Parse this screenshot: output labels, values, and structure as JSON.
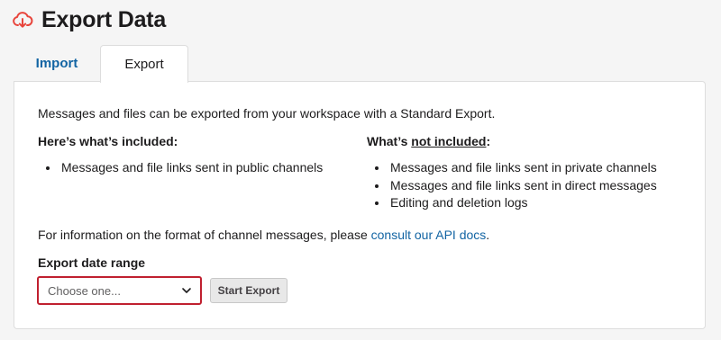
{
  "header": {
    "title": "Export Data",
    "icon": "cloud-download-icon",
    "icon_color": "#e8453c"
  },
  "tabs": [
    {
      "label": "Import",
      "active": false
    },
    {
      "label": "Export",
      "active": true
    }
  ],
  "panel": {
    "intro": "Messages and files can be exported from your workspace with a Standard Export.",
    "included": {
      "heading": "Here’s what’s included:",
      "items": [
        "Messages and file links sent in public channels"
      ]
    },
    "not_included": {
      "heading_prefix": "What’s ",
      "heading_underlined": "not included",
      "heading_suffix": ":",
      "items": [
        "Messages and file links sent in private channels",
        "Messages and file links sent in direct messages",
        "Editing and deletion logs"
      ]
    },
    "info_prefix": "For information on the format of channel messages, please ",
    "info_link": "consult our API docs",
    "info_suffix": ".",
    "date_range_label": "Export date range",
    "date_range_placeholder": "Choose one...",
    "start_button": "Start Export"
  },
  "colors": {
    "link": "#1264a3",
    "select_border": "#c0202f"
  }
}
